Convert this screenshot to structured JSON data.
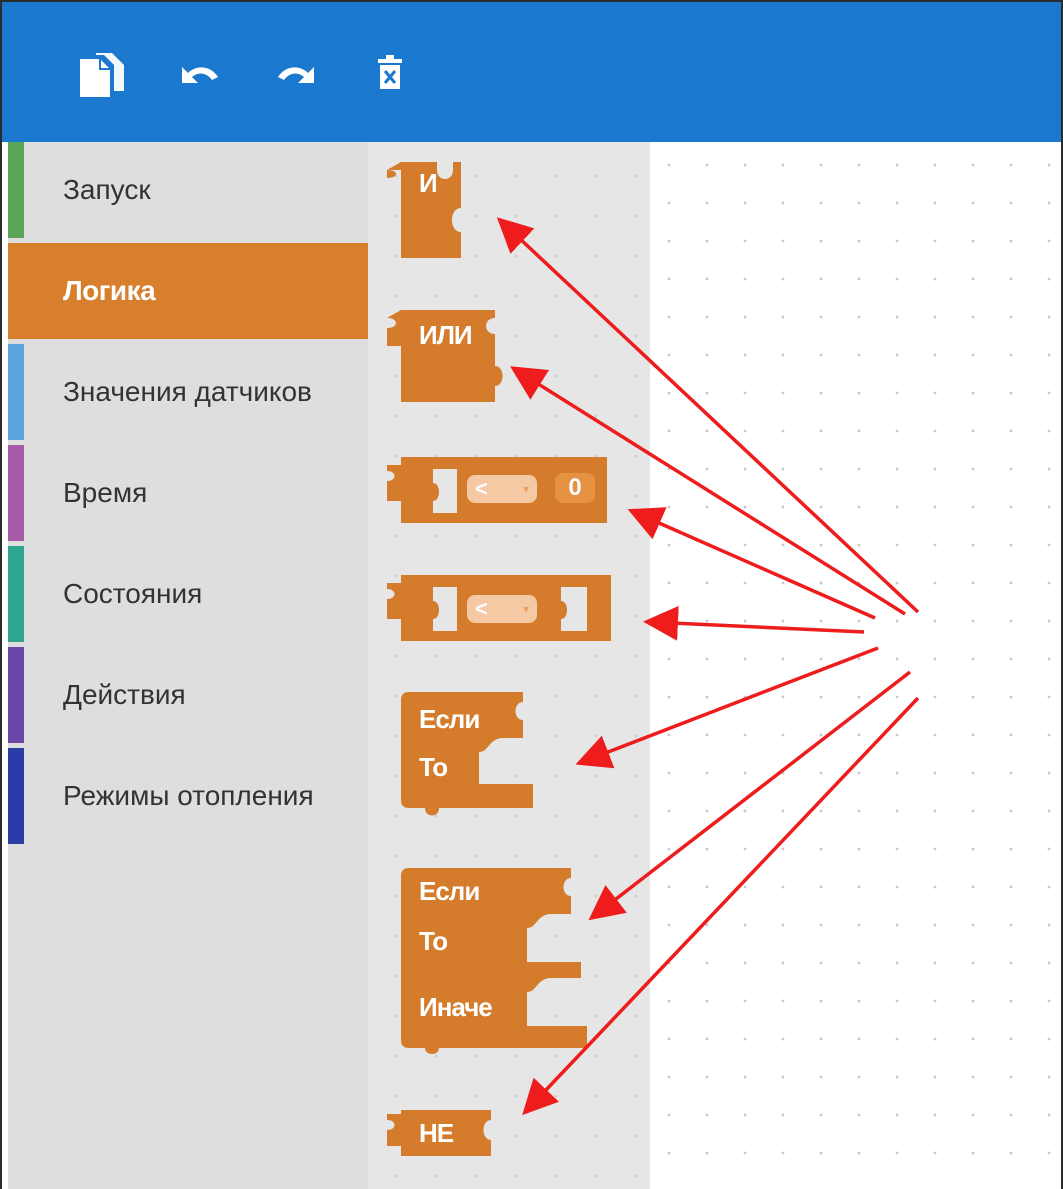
{
  "toolbar": {
    "buttons": [
      {
        "icon": "copy-icon"
      },
      {
        "icon": "undo-icon"
      },
      {
        "icon": "redo-icon"
      },
      {
        "icon": "delete-icon"
      }
    ]
  },
  "colors": {
    "toolbar": "#1a78cf",
    "logic_block": "#d47c2c",
    "selected_category": "#d87f2e",
    "annotation_arrow": "#ee1c1c"
  },
  "categories": [
    {
      "label": "Запуск",
      "color": "#5ba55b"
    },
    {
      "label": "Логика",
      "color": "#d87f2e",
      "selected": true
    },
    {
      "label": "Значения датчиков",
      "color": "#5ba5e0"
    },
    {
      "label": "Время",
      "color": "#a55ba5"
    },
    {
      "label": "Состояния",
      "color": "#2fa58f"
    },
    {
      "label": "Действия",
      "color": "#6a46a8"
    },
    {
      "label": "Режимы отопления",
      "color": "#2c3aa8"
    }
  ],
  "blocks": {
    "and": {
      "label": "И"
    },
    "or": {
      "label": "ИЛИ"
    },
    "compare_number": {
      "operator": "<",
      "value": "0"
    },
    "compare": {
      "operator": "<"
    },
    "if_then": {
      "if_label": "Если",
      "then_label": "То"
    },
    "if_then_else": {
      "if_label": "Если",
      "then_label": "То",
      "else_label": "Иначе"
    },
    "not": {
      "label": "НЕ"
    }
  }
}
